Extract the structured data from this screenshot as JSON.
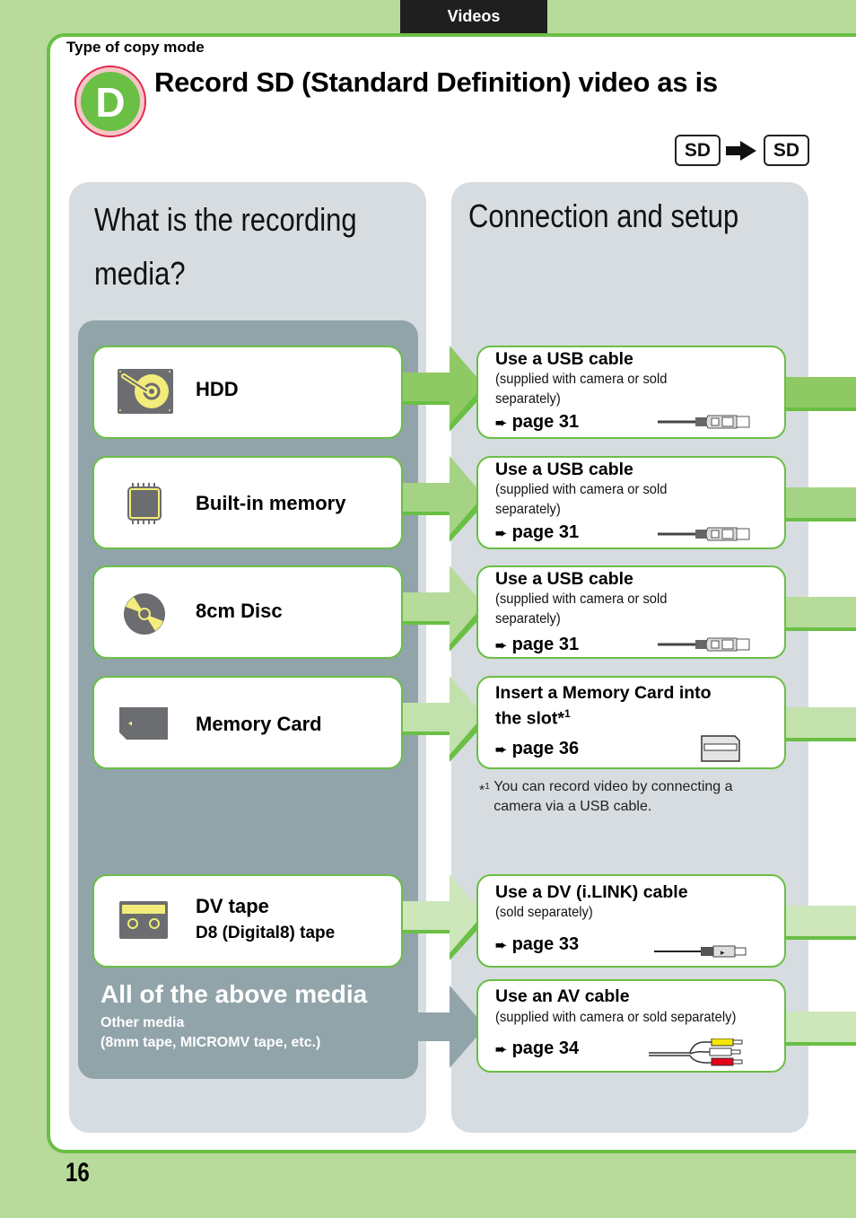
{
  "header": {
    "tab_label": "Videos",
    "section_label": "Type of copy mode",
    "badge_letter": "D",
    "title": "Record SD (Standard Definition) video as is",
    "format_from": "SD",
    "format_to": "SD"
  },
  "left_panel": {
    "heading_line1": "What is the recording",
    "heading_line2": "media?",
    "media": [
      {
        "label": "HDD",
        "icon": "hdd-icon"
      },
      {
        "label": "Built-in memory",
        "icon": "memory-chip-icon"
      },
      {
        "label": "8cm Disc",
        "icon": "disc-icon"
      },
      {
        "label": "Memory Card",
        "icon": "memory-card-icon"
      },
      {
        "label": "DV tape",
        "sublabel": "D8 (Digital8) tape",
        "icon": "tape-cassette-icon"
      }
    ],
    "all_media": {
      "title": "All of the above media",
      "sub_line1": "Other media",
      "sub_line2": "(8mm tape, MICROMV tape, etc.)"
    }
  },
  "right_panel": {
    "heading": "Connection and setup",
    "connections": [
      {
        "title": "Use a USB cable",
        "desc_line1": "(supplied with camera or sold",
        "desc_line2": "separately)",
        "page": "page 31",
        "icon": "usb-cable-icon"
      },
      {
        "title": "Use a USB cable",
        "desc_line1": "(supplied with camera or sold",
        "desc_line2": "separately)",
        "page": "page 31",
        "icon": "usb-cable-icon"
      },
      {
        "title": "Use a USB cable",
        "desc_line1": "(supplied with camera or sold",
        "desc_line2": "separately)",
        "page": "page 31",
        "icon": "usb-cable-icon"
      },
      {
        "title_line1": "Insert a Memory Card into",
        "title_line2": "the slot*",
        "title_sup": "1",
        "page": "page 36",
        "icon": "memory-card-slot-icon"
      },
      {
        "title": "Use a DV (i.LINK) cable",
        "desc_line1": "(sold separately)",
        "page": "page 33",
        "icon": "ilink-cable-icon"
      },
      {
        "title": "Use an AV cable",
        "desc_line1": "(supplied with camera or sold separately)",
        "page": "page 34",
        "icon": "av-cable-icon"
      }
    ],
    "footnote": {
      "marker": "*",
      "marker_sup": "1",
      "text": "You can record video by connecting a camera via a USB cable."
    }
  },
  "colors": {
    "page_bg": "#b8db9c",
    "accent_green": "#6abf45",
    "arrow_green_1": "#8fc964",
    "arrow_green_2": "#a5d386",
    "arrow_green_3": "#b6db9b",
    "arrow_green_4": "#c3e1ad",
    "arrow_green_5": "#cde6ba",
    "arrow_gray": "#91a4aa",
    "panel_gray": "#d6dcdf",
    "media_bg": "#91a4aa",
    "badge_red": "#e0284b"
  },
  "footer": {
    "page_number": "16"
  }
}
